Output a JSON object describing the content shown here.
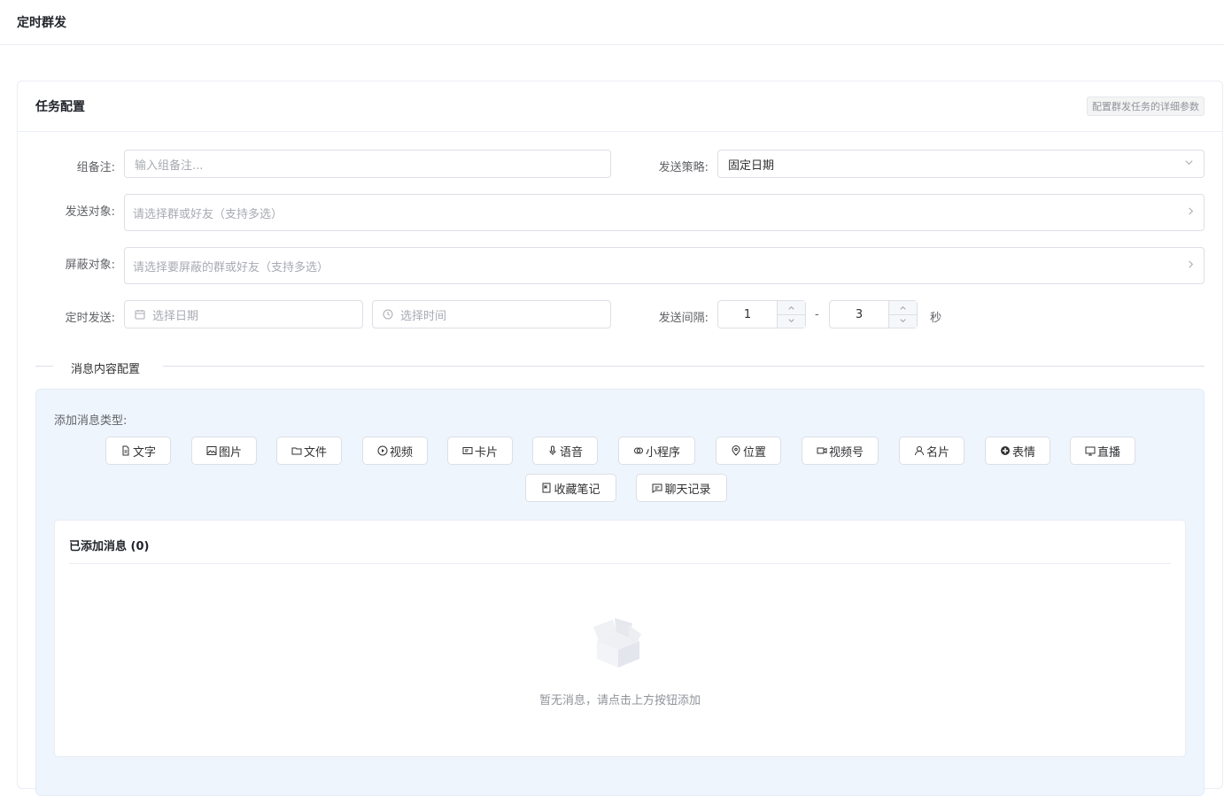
{
  "page": {
    "title": "定时群发"
  },
  "card": {
    "title": "任务配置",
    "tag": "配置群发任务的详细参数"
  },
  "form": {
    "group_note": {
      "label": "组备注:",
      "placeholder": "输入组备注..."
    },
    "strategy": {
      "label": "发送策略:",
      "value": "固定日期"
    },
    "targets": {
      "label": "发送对象:",
      "placeholder": "请选择群或好友（支持多选）"
    },
    "blocked": {
      "label": "屏蔽对象:",
      "placeholder": "请选择要屏蔽的群或好友（支持多选）"
    },
    "schedule": {
      "label": "定时发送:",
      "date_placeholder": "选择日期",
      "time_placeholder": "选择时间"
    },
    "interval": {
      "label": "发送间隔:",
      "min": "1",
      "separator": "-",
      "max": "3",
      "unit": "秒"
    }
  },
  "section": {
    "title": "消息内容配置"
  },
  "message_types": {
    "label": "添加消息类型:",
    "buttons": [
      "文字",
      "图片",
      "文件",
      "视频",
      "卡片",
      "语音",
      "小程序",
      "位置",
      "视频号",
      "名片",
      "表情",
      "直播",
      "收藏笔记",
      "聊天记录"
    ]
  },
  "added": {
    "title": "已添加消息 (0)",
    "empty_text": "暂无消息，请点击上方按钮添加"
  }
}
